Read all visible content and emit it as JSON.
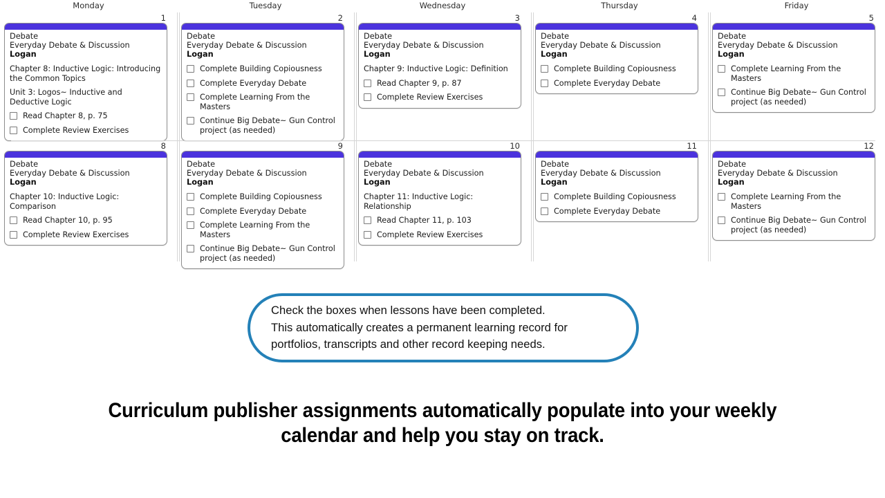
{
  "calendar": {
    "day_headers": [
      "Monday",
      "Tuesday",
      "Wednesday",
      "Thursday",
      "Friday"
    ],
    "accent_color": "#4b33dd",
    "rows": [
      {
        "cells": [
          {
            "date": "1",
            "subject": "Debate",
            "course": "Everyday Debate & Discussion",
            "student": "Logan",
            "chapter": "Chapter 8: Inductive Logic: Introducing the Common Topics",
            "unit": "Unit 3: Logos~ Inductive and Deductive Logic",
            "tasks": [
              "Read Chapter 8, p. 75",
              "Complete Review Exercises"
            ]
          },
          {
            "date": "2",
            "subject": "Debate",
            "course": "Everyday Debate & Discussion",
            "student": "Logan",
            "chapter": "",
            "unit": "",
            "tasks": [
              "Complete Building Copiousness",
              "Complete Everyday Debate",
              "Complete Learning From the Masters",
              "Continue Big Debate~ Gun Control project (as needed)"
            ]
          },
          {
            "date": "3",
            "subject": "Debate",
            "course": "Everyday Debate & Discussion",
            "student": "Logan",
            "chapter": "Chapter 9: Inductive Logic: Definition",
            "unit": "",
            "tasks": [
              "Read Chapter 9, p. 87",
              "Complete Review Exercises"
            ]
          },
          {
            "date": "4",
            "subject": "Debate",
            "course": "Everyday Debate & Discussion",
            "student": "Logan",
            "chapter": "",
            "unit": "",
            "tasks": [
              "Complete Building Copiousness",
              "Complete Everyday Debate"
            ]
          },
          {
            "date": "5",
            "subject": "Debate",
            "course": "Everyday Debate & Discussion",
            "student": "Logan",
            "chapter": "",
            "unit": "",
            "tasks": [
              "Complete Learning From the Masters",
              "Continue Big Debate~ Gun Control project (as needed)"
            ]
          }
        ]
      },
      {
        "cells": [
          {
            "date": "8",
            "subject": "Debate",
            "course": "Everyday Debate & Discussion",
            "student": "Logan",
            "chapter": "Chapter 10: Inductive Logic: Comparison",
            "unit": "",
            "tasks": [
              "Read Chapter 10, p. 95",
              "Complete Review Exercises"
            ]
          },
          {
            "date": "9",
            "subject": "Debate",
            "course": "Everyday Debate & Discussion",
            "student": "Logan",
            "chapter": "",
            "unit": "",
            "tasks": [
              "Complete Building Copiousness",
              "Complete Everyday Debate",
              "Complete Learning From the Masters",
              "Continue Big Debate~ Gun Control project (as needed)"
            ]
          },
          {
            "date": "10",
            "subject": "Debate",
            "course": "Everyday Debate & Discussion",
            "student": "Logan",
            "chapter": "Chapter 11: Inductive Logic: Relationship",
            "unit": "",
            "tasks": [
              "Read Chapter 11, p. 103",
              "Complete Review Exercises"
            ]
          },
          {
            "date": "11",
            "subject": "Debate",
            "course": "Everyday Debate & Discussion",
            "student": "Logan",
            "chapter": "",
            "unit": "",
            "tasks": [
              "Complete Building Copiousness",
              "Complete Everyday Debate"
            ]
          },
          {
            "date": "12",
            "subject": "Debate",
            "course": "Everyday Debate & Discussion",
            "student": "Logan",
            "chapter": "",
            "unit": "",
            "tasks": [
              "Complete Learning From the Masters",
              "Continue Big Debate~ Gun Control project (as needed)"
            ]
          }
        ]
      }
    ]
  },
  "callout": {
    "border_color": "#2481b8",
    "lines": [
      "Check the boxes when lessons have been completed.",
      "This automatically creates a permanent learning record for",
      "portfolios, transcripts and other record keeping needs."
    ]
  },
  "headline": {
    "lines": [
      "Curriculum publisher assignments automatically populate into your weekly",
      "calendar and help you stay on track."
    ]
  }
}
